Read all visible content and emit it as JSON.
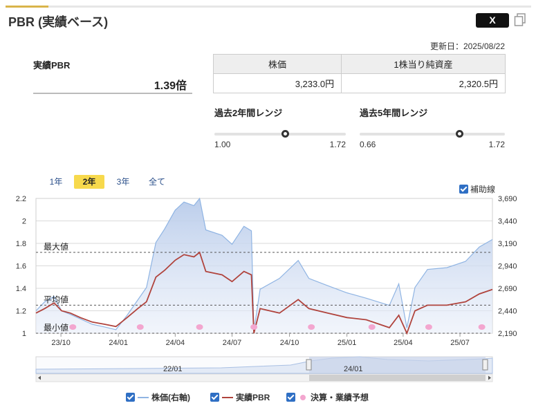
{
  "header": {
    "title": "PBR (実績ベース)",
    "share_label": "X",
    "updated": "更新日：2025/08/22"
  },
  "pbr": {
    "label": "実績PBR",
    "value": "1.39倍"
  },
  "table": {
    "headers": [
      "株価",
      "1株当り純資産"
    ],
    "values": [
      "3,233.0円",
      "2,320.5円"
    ]
  },
  "ranges": [
    {
      "label": "過去2年間レンジ",
      "min": "1.00",
      "max": "1.72",
      "current": 1.39,
      "min_v": 1.0,
      "max_v": 1.72
    },
    {
      "label": "過去5年間レンジ",
      "min": "0.66",
      "max": "1.72",
      "current": 1.39,
      "min_v": 0.66,
      "max_v": 1.72
    }
  ],
  "tabs": [
    {
      "label": "1年",
      "active": false
    },
    {
      "label": "2年",
      "active": true
    },
    {
      "label": "3年",
      "active": false
    },
    {
      "label": "全て",
      "active": false
    }
  ],
  "aux_label": "補助線",
  "navigator": {
    "labels": [
      "22/01",
      "24/01"
    ]
  },
  "legend": {
    "price": "株価(右軸)",
    "pbr": "実績PBR",
    "events": "決算・業績予想"
  },
  "colors": {
    "pbr_line": "#b0433c",
    "price_line": "#8fb4e3",
    "price_fill": "#c9d8ef",
    "events": "#f3a6cf",
    "accent": "#f7d94c",
    "check": "#2f6fc4"
  },
  "chart_data": {
    "type": "line",
    "x_ticks": [
      "23/10",
      "24/01",
      "24/04",
      "24/07",
      "24/10",
      "25/01",
      "25/04",
      "25/07"
    ],
    "y_left_ticks": [
      "2.2",
      "2",
      "1.8",
      "1.6",
      "1.4",
      "1.2",
      "1"
    ],
    "y_right_ticks": [
      "3,690",
      "3,440",
      "3,190",
      "2,940",
      "2,690",
      "2,440",
      "2,190"
    ],
    "ylim_left": [
      1,
      2.2
    ],
    "ylim_right": [
      2190,
      3690
    ],
    "xlim": [
      "2023-08-22",
      "2025-08-22"
    ],
    "grid": true,
    "annotations": [
      {
        "label": "最大値",
        "y": 1.72
      },
      {
        "label": "平均値",
        "y": 1.25
      },
      {
        "label": "最小値",
        "y": 1.0
      }
    ],
    "series": [
      {
        "name": "実績PBR",
        "axis": "left",
        "points": [
          [
            "2023-08-22",
            1.18
          ],
          [
            "2023-09-05",
            1.22
          ],
          [
            "2023-09-20",
            1.27
          ],
          [
            "2023-10-02",
            1.2
          ],
          [
            "2023-10-16",
            1.18
          ],
          [
            "2023-11-01",
            1.14
          ],
          [
            "2023-11-20",
            1.1
          ],
          [
            "2023-12-10",
            1.08
          ],
          [
            "2023-12-28",
            1.06
          ],
          [
            "2024-01-15",
            1.14
          ],
          [
            "2024-02-01",
            1.22
          ],
          [
            "2024-02-15",
            1.28
          ],
          [
            "2024-03-01",
            1.5
          ],
          [
            "2024-03-15",
            1.56
          ],
          [
            "2024-04-01",
            1.65
          ],
          [
            "2024-04-15",
            1.7
          ],
          [
            "2024-05-01",
            1.68
          ],
          [
            "2024-05-10",
            1.72
          ],
          [
            "2024-05-20",
            1.55
          ],
          [
            "2024-06-15",
            1.52
          ],
          [
            "2024-07-01",
            1.46
          ],
          [
            "2024-07-20",
            1.55
          ],
          [
            "2024-08-01",
            1.52
          ],
          [
            "2024-08-05",
            1.0
          ],
          [
            "2024-08-15",
            1.22
          ],
          [
            "2024-09-15",
            1.18
          ],
          [
            "2024-10-15",
            1.3
          ],
          [
            "2024-11-01",
            1.22
          ],
          [
            "2024-12-01",
            1.18
          ],
          [
            "2025-01-01",
            1.14
          ],
          [
            "2025-02-01",
            1.12
          ],
          [
            "2025-03-10",
            1.05
          ],
          [
            "2025-03-25",
            1.16
          ],
          [
            "2025-04-07",
            1.0
          ],
          [
            "2025-04-20",
            1.2
          ],
          [
            "2025-05-10",
            1.25
          ],
          [
            "2025-06-10",
            1.25
          ],
          [
            "2025-07-10",
            1.28
          ],
          [
            "2025-08-01",
            1.35
          ],
          [
            "2025-08-22",
            1.39
          ]
        ]
      },
      {
        "name": "株価(右軸)",
        "axis": "right",
        "points": [
          [
            "2023-08-22",
            2440
          ],
          [
            "2023-09-05",
            2540
          ],
          [
            "2023-09-20",
            2600
          ],
          [
            "2023-10-02",
            2440
          ],
          [
            "2023-10-16",
            2400
          ],
          [
            "2023-11-01",
            2350
          ],
          [
            "2023-11-20",
            2290
          ],
          [
            "2023-12-10",
            2260
          ],
          [
            "2023-12-28",
            2230
          ],
          [
            "2024-01-15",
            2390
          ],
          [
            "2024-02-01",
            2560
          ],
          [
            "2024-02-15",
            2700
          ],
          [
            "2024-03-01",
            3200
          ],
          [
            "2024-03-15",
            3350
          ],
          [
            "2024-04-01",
            3560
          ],
          [
            "2024-04-15",
            3650
          ],
          [
            "2024-05-01",
            3610
          ],
          [
            "2024-05-10",
            3690
          ],
          [
            "2024-05-20",
            3340
          ],
          [
            "2024-06-15",
            3280
          ],
          [
            "2024-07-01",
            3180
          ],
          [
            "2024-07-20",
            3380
          ],
          [
            "2024-08-01",
            3330
          ],
          [
            "2024-08-05",
            2220
          ],
          [
            "2024-08-15",
            2680
          ],
          [
            "2024-09-15",
            2800
          ],
          [
            "2024-10-15",
            3000
          ],
          [
            "2024-11-01",
            2800
          ],
          [
            "2024-12-01",
            2720
          ],
          [
            "2025-01-01",
            2640
          ],
          [
            "2025-02-01",
            2580
          ],
          [
            "2025-03-10",
            2500
          ],
          [
            "2025-03-25",
            2740
          ],
          [
            "2025-04-07",
            2250
          ],
          [
            "2025-04-20",
            2700
          ],
          [
            "2025-05-10",
            2900
          ],
          [
            "2025-06-10",
            2920
          ],
          [
            "2025-07-10",
            2990
          ],
          [
            "2025-08-01",
            3150
          ],
          [
            "2025-08-22",
            3233
          ]
        ]
      }
    ],
    "events": [
      "2023-10-20",
      "2024-02-05",
      "2024-05-10",
      "2024-08-05",
      "2024-11-05",
      "2025-02-10",
      "2025-05-12",
      "2025-08-05"
    ]
  }
}
